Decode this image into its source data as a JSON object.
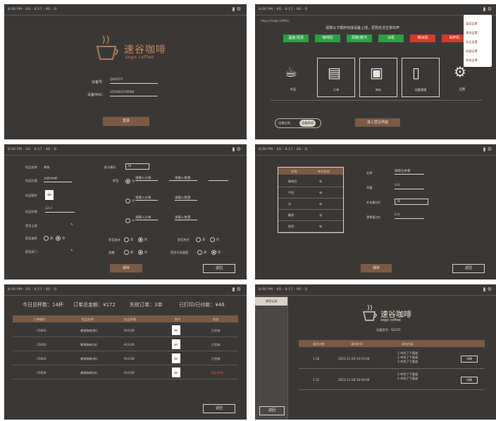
{
  "status": {
    "left": "8:00 PM  ·  4G  ·  6:17  ·  86  ·  Q",
    "right": "▮ ⚙"
  },
  "login": {
    "brand_cn": "速谷咖啡",
    "brand_en": "sogo coffee",
    "device_label": "设备号:",
    "device_value": "QSD0TV",
    "mac_label": "设备MAC:",
    "mac_value": "201904378989",
    "login_button": "登录"
  },
  "home": {
    "url": "https://sogo.coffee/",
    "notice": "请按以下顺序完成设备上线，否则无法正常出杯",
    "status_buttons": [
      {
        "label": "温度/清洗",
        "color": "#2f9e44"
      },
      {
        "label": "咖啡机",
        "color": "#2f9e44"
      },
      {
        "label": "研磨/蒸汽",
        "color": "#2f9e44"
      },
      {
        "label": "冰柜",
        "color": "#2f9e44"
      },
      {
        "label": "制冰机",
        "color": "#d33b2a"
      },
      {
        "label": "出杯机",
        "color": "#d33b2a"
      }
    ],
    "tiles": [
      {
        "label": "饮品",
        "icon": "coffee-cup-icon"
      },
      {
        "label": "订单",
        "icon": "receipt-icon"
      },
      {
        "label": "库存",
        "icon": "box-icon"
      },
      {
        "label": "设备管理",
        "icon": "phone-icon"
      },
      {
        "label": "设置",
        "icon": "gear-icon"
      }
    ],
    "toggle_left": "设备在线",
    "toggle_right": "设备离线",
    "enter_button": "进入营业界面",
    "dropdown_items": [
      "温度设置",
      "清洗设置",
      "饮品设置",
      "机器设置",
      "系统设置"
    ]
  },
  "product_form": {
    "name_label": "饮品名称",
    "name_value": "拿铁",
    "category_label": "饮品分类",
    "category_value": "大杯/中杯",
    "image_label": "饮品图片",
    "price_label": "饮品价格",
    "price_value": "12.0",
    "onsale_label": "是否上架",
    "recipe_label": "配方编号",
    "recipe_value": "16",
    "cup_label": "杯型",
    "cup_options": [
      "大",
      "中",
      "小"
    ],
    "cup_field_placeholders": [
      "请输入价格",
      "请输入数量",
      "请输入价格",
      "请输入数量",
      "请输入价格",
      "请输入数量"
    ],
    "radio_rows": [
      {
        "label": "是否推荐",
        "opts": [
          "是",
          "否"
        ]
      },
      {
        "label": "是否加冰",
        "opts": [
          "是",
          "否"
        ]
      },
      {
        "label": "是否热饮",
        "opts": [
          "是",
          "否"
        ]
      },
      {
        "label": "加糖",
        "opts": [
          "是",
          "否"
        ]
      },
      {
        "label": "是否可选温度",
        "opts": [
          "是",
          "否"
        ]
      }
    ],
    "hot_label": "是否热门",
    "save_button": "保存",
    "back_button": "返回"
  },
  "inventory": {
    "headers": [
      "名称",
      "库存状态"
    ],
    "rows": [
      [
        "咖啡豆",
        "有"
      ],
      [
        "牛奶",
        "有"
      ],
      [
        "冰",
        "有"
      ],
      [
        "糖浆",
        "无"
      ],
      [
        "纸杯",
        "有"
      ]
    ],
    "fields": [
      {
        "label": "名称",
        "value": "咖啡豆余量"
      },
      {
        "label": "余量",
        "value": "0.0"
      },
      {
        "label": "补充量(克)",
        "value": "30"
      },
      {
        "label": "预警值(克)",
        "value": "0.0"
      }
    ],
    "save_button": "保存",
    "back_button": "返回"
  },
  "orders": {
    "summary": [
      "今日总杯数：14杯",
      "订单总金额：¥172",
      "失败订单：3单",
      "已打印/已付款：¥48"
    ],
    "headers": [
      "订单编号",
      "饮品名称",
      "饮品价格",
      "图片",
      "状态"
    ],
    "rows": [
      [
        "CS001",
        "拿铁咖啡(热)",
        "¥14.00",
        "已完成"
      ],
      [
        "CS002",
        "拿铁咖啡(冰)",
        "¥14.00",
        "已完成"
      ],
      [
        "CS003",
        "拿铁咖啡(热)",
        "¥14.00",
        "已完成"
      ],
      [
        "CS004",
        "拿铁咖啡(冰)",
        "¥14.00",
        "制作失败"
      ]
    ],
    "back_button": "返回"
  },
  "maintenance": {
    "side_tab": "清洗记录",
    "brand_cn": "速谷咖啡",
    "brand_en": "sogo coffee",
    "device_text": "设备型号：SGC01",
    "headers": [
      "清洗次数",
      "清洗时间",
      "清洗内容",
      ""
    ],
    "rows": [
      {
        "count": "1.32",
        "time": "2021-11-29 14:19:38",
        "content": [
          "1.冲洗了下管道",
          "2.冲洗了下管道",
          "3.冲洗了下管道"
        ],
        "action": "详情"
      },
      {
        "count": "1.31",
        "time": "2021-11-28 18:44:06",
        "content": [
          "1.冲洗了下管道",
          "2.冲洗了下管道"
        ],
        "action": "详情"
      }
    ],
    "back_button": "返回"
  }
}
